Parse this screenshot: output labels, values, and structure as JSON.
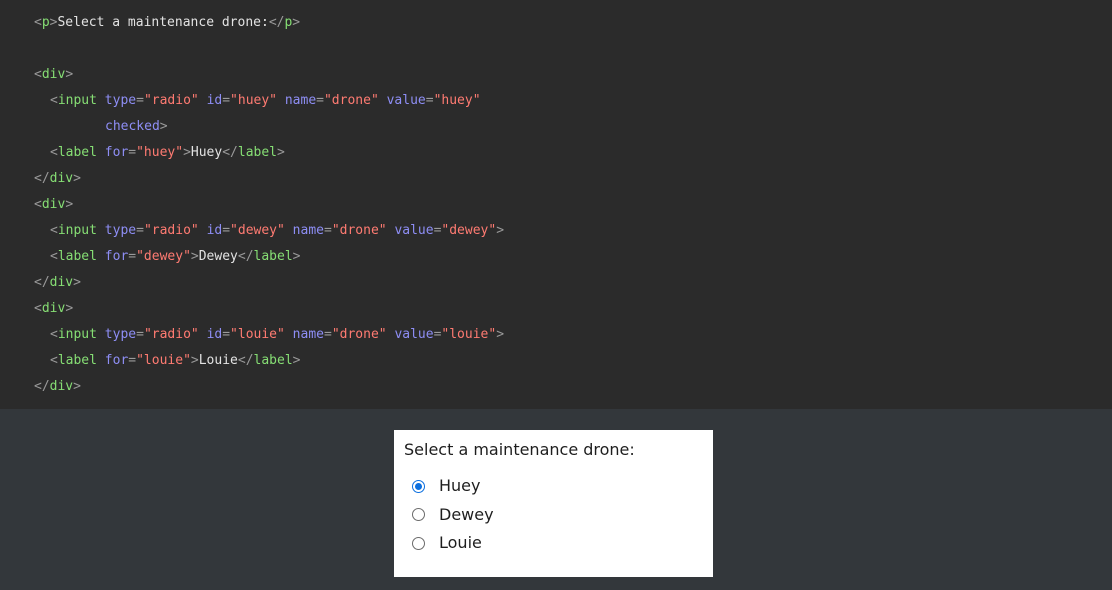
{
  "code_lines": [
    {
      "id": "l1",
      "tokens": [
        {
          "c": "tk-punct",
          "t": "<"
        },
        {
          "c": "tk-tag",
          "t": "p"
        },
        {
          "c": "tk-punct",
          "t": ">"
        },
        {
          "c": "tk-text",
          "t": "Select a maintenance drone:"
        },
        {
          "c": "tk-punct",
          "t": "</"
        },
        {
          "c": "tk-tag",
          "t": "p"
        },
        {
          "c": "tk-punct",
          "t": ">"
        }
      ]
    },
    {
      "id": "blank",
      "tokens": []
    },
    {
      "id": "l3",
      "tokens": [
        {
          "c": "tk-punct",
          "t": "<"
        },
        {
          "c": "tk-tag",
          "t": "div"
        },
        {
          "c": "tk-punct",
          "t": ">"
        }
      ]
    },
    {
      "id": "l4",
      "tokens": [
        {
          "c": "tk-punct",
          "t": "<"
        },
        {
          "c": "tk-tag",
          "t": "input"
        },
        {
          "c": "tk-text",
          "t": " "
        },
        {
          "c": "tk-attr",
          "t": "type"
        },
        {
          "c": "tk-punct",
          "t": "="
        },
        {
          "c": "tk-str",
          "t": "\"radio\""
        },
        {
          "c": "tk-text",
          "t": " "
        },
        {
          "c": "tk-attr",
          "t": "id"
        },
        {
          "c": "tk-punct",
          "t": "="
        },
        {
          "c": "tk-str",
          "t": "\"huey\""
        },
        {
          "c": "tk-text",
          "t": " "
        },
        {
          "c": "tk-attr",
          "t": "name"
        },
        {
          "c": "tk-punct",
          "t": "="
        },
        {
          "c": "tk-str",
          "t": "\"drone\""
        },
        {
          "c": "tk-text",
          "t": " "
        },
        {
          "c": "tk-attr",
          "t": "value"
        },
        {
          "c": "tk-punct",
          "t": "="
        },
        {
          "c": "tk-str",
          "t": "\"huey\""
        }
      ]
    },
    {
      "id": "l5",
      "tokens": [
        {
          "c": "tk-attr",
          "t": "checked"
        },
        {
          "c": "tk-punct",
          "t": ">"
        }
      ]
    },
    {
      "id": "l6",
      "tokens": [
        {
          "c": "tk-punct",
          "t": "<"
        },
        {
          "c": "tk-tag",
          "t": "label"
        },
        {
          "c": "tk-text",
          "t": " "
        },
        {
          "c": "tk-attr",
          "t": "for"
        },
        {
          "c": "tk-punct",
          "t": "="
        },
        {
          "c": "tk-str",
          "t": "\"huey\""
        },
        {
          "c": "tk-punct",
          "t": ">"
        },
        {
          "c": "tk-text",
          "t": "Huey"
        },
        {
          "c": "tk-punct",
          "t": "</"
        },
        {
          "c": "tk-tag",
          "t": "label"
        },
        {
          "c": "tk-punct",
          "t": ">"
        }
      ]
    },
    {
      "id": "l7",
      "tokens": [
        {
          "c": "tk-punct",
          "t": "</"
        },
        {
          "c": "tk-tag",
          "t": "div"
        },
        {
          "c": "tk-punct",
          "t": ">"
        }
      ]
    },
    {
      "id": "l8",
      "tokens": [
        {
          "c": "tk-punct",
          "t": "<"
        },
        {
          "c": "tk-tag",
          "t": "div"
        },
        {
          "c": "tk-punct",
          "t": ">"
        }
      ]
    },
    {
      "id": "l9",
      "tokens": [
        {
          "c": "tk-punct",
          "t": "<"
        },
        {
          "c": "tk-tag",
          "t": "input"
        },
        {
          "c": "tk-text",
          "t": " "
        },
        {
          "c": "tk-attr",
          "t": "type"
        },
        {
          "c": "tk-punct",
          "t": "="
        },
        {
          "c": "tk-str",
          "t": "\"radio\""
        },
        {
          "c": "tk-text",
          "t": " "
        },
        {
          "c": "tk-attr",
          "t": "id"
        },
        {
          "c": "tk-punct",
          "t": "="
        },
        {
          "c": "tk-str",
          "t": "\"dewey\""
        },
        {
          "c": "tk-text",
          "t": " "
        },
        {
          "c": "tk-attr",
          "t": "name"
        },
        {
          "c": "tk-punct",
          "t": "="
        },
        {
          "c": "tk-str",
          "t": "\"drone\""
        },
        {
          "c": "tk-text",
          "t": " "
        },
        {
          "c": "tk-attr",
          "t": "value"
        },
        {
          "c": "tk-punct",
          "t": "="
        },
        {
          "c": "tk-str",
          "t": "\"dewey\""
        },
        {
          "c": "tk-punct",
          "t": ">"
        }
      ]
    },
    {
      "id": "l10",
      "tokens": [
        {
          "c": "tk-punct",
          "t": "<"
        },
        {
          "c": "tk-tag",
          "t": "label"
        },
        {
          "c": "tk-text",
          "t": " "
        },
        {
          "c": "tk-attr",
          "t": "for"
        },
        {
          "c": "tk-punct",
          "t": "="
        },
        {
          "c": "tk-str",
          "t": "\"dewey\""
        },
        {
          "c": "tk-punct",
          "t": ">"
        },
        {
          "c": "tk-text",
          "t": "Dewey"
        },
        {
          "c": "tk-punct",
          "t": "</"
        },
        {
          "c": "tk-tag",
          "t": "label"
        },
        {
          "c": "tk-punct",
          "t": ">"
        }
      ]
    },
    {
      "id": "l11",
      "tokens": [
        {
          "c": "tk-punct",
          "t": "</"
        },
        {
          "c": "tk-tag",
          "t": "div"
        },
        {
          "c": "tk-punct",
          "t": ">"
        }
      ]
    },
    {
      "id": "l12",
      "tokens": [
        {
          "c": "tk-punct",
          "t": "<"
        },
        {
          "c": "tk-tag",
          "t": "div"
        },
        {
          "c": "tk-punct",
          "t": ">"
        }
      ]
    },
    {
      "id": "l13",
      "tokens": [
        {
          "c": "tk-punct",
          "t": "<"
        },
        {
          "c": "tk-tag",
          "t": "input"
        },
        {
          "c": "tk-text",
          "t": " "
        },
        {
          "c": "tk-attr",
          "t": "type"
        },
        {
          "c": "tk-punct",
          "t": "="
        },
        {
          "c": "tk-str",
          "t": "\"radio\""
        },
        {
          "c": "tk-text",
          "t": " "
        },
        {
          "c": "tk-attr",
          "t": "id"
        },
        {
          "c": "tk-punct",
          "t": "="
        },
        {
          "c": "tk-str",
          "t": "\"louie\""
        },
        {
          "c": "tk-text",
          "t": " "
        },
        {
          "c": "tk-attr",
          "t": "name"
        },
        {
          "c": "tk-punct",
          "t": "="
        },
        {
          "c": "tk-str",
          "t": "\"drone\""
        },
        {
          "c": "tk-text",
          "t": " "
        },
        {
          "c": "tk-attr",
          "t": "value"
        },
        {
          "c": "tk-punct",
          "t": "="
        },
        {
          "c": "tk-str",
          "t": "\"louie\""
        },
        {
          "c": "tk-punct",
          "t": ">"
        }
      ]
    },
    {
      "id": "l14",
      "tokens": [
        {
          "c": "tk-punct",
          "t": "<"
        },
        {
          "c": "tk-tag",
          "t": "label"
        },
        {
          "c": "tk-text",
          "t": " "
        },
        {
          "c": "tk-attr",
          "t": "for"
        },
        {
          "c": "tk-punct",
          "t": "="
        },
        {
          "c": "tk-str",
          "t": "\"louie\""
        },
        {
          "c": "tk-punct",
          "t": ">"
        },
        {
          "c": "tk-text",
          "t": "Louie"
        },
        {
          "c": "tk-punct",
          "t": "</"
        },
        {
          "c": "tk-tag",
          "t": "label"
        },
        {
          "c": "tk-punct",
          "t": ">"
        }
      ]
    },
    {
      "id": "l15",
      "tokens": [
        {
          "c": "tk-punct",
          "t": "</"
        },
        {
          "c": "tk-tag",
          "t": "div"
        },
        {
          "c": "tk-punct",
          "t": ">"
        }
      ]
    }
  ],
  "output": {
    "prompt": "Select a maintenance drone:",
    "options": [
      {
        "label": "Huey",
        "checked": true
      },
      {
        "label": "Dewey",
        "checked": false
      },
      {
        "label": "Louie",
        "checked": false
      }
    ]
  },
  "colors": {
    "code_background": "#2b2b2b",
    "page_background": "#33373b",
    "tag": "#86de74",
    "attribute": "#8e8ef5",
    "string": "#ff7b72",
    "radio_checked": "#0b6fdf"
  }
}
